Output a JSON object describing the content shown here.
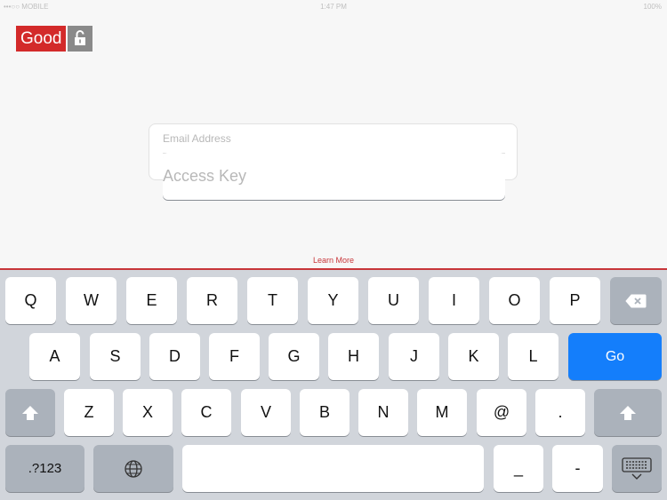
{
  "status_bar": {
    "carrier": "•••○○ MOBILE",
    "time": "1:47 PM",
    "battery": "100%"
  },
  "logo": {
    "text": "Good"
  },
  "form": {
    "email_placeholder": "Email Address",
    "access_key_placeholder": "Access Key"
  },
  "learn_more": "Learn More",
  "accent_color": "#c8363a",
  "keyboard": {
    "row1": [
      "Q",
      "W",
      "E",
      "R",
      "T",
      "Y",
      "U",
      "I",
      "O",
      "P"
    ],
    "row2": [
      "A",
      "S",
      "D",
      "F",
      "G",
      "H",
      "J",
      "K",
      "L"
    ],
    "row3": [
      "Z",
      "X",
      "C",
      "V",
      "B",
      "N",
      "M",
      "@",
      "."
    ],
    "go_label": "Go",
    "numbers_label": ".?123",
    "underscore": "_",
    "dash": "-"
  }
}
